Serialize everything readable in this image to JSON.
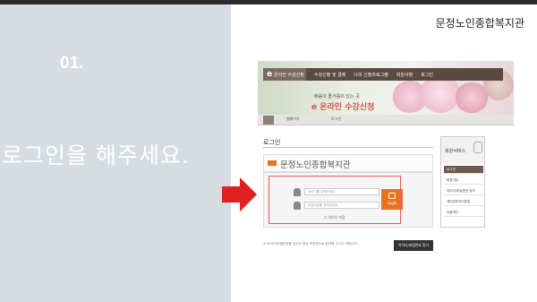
{
  "slide": {
    "title": "문정노인종합복지관",
    "step_number": "01.",
    "step_text": "로그인을 해주세요."
  },
  "site": {
    "logo_text": "온라인 수강신청",
    "nav": [
      "수강신청 및 결제",
      "나의 신청프로그램",
      "회원사항",
      "로그인"
    ],
    "slogan_small": "배움의 즐거움이 있는 곳",
    "slogan_large": "e 온라인 수강신청",
    "breadcrumbs": [
      "웹페이지",
      "로그인"
    ],
    "page_heading": "로그인",
    "org_name": "문정노인종합복지관",
    "id_placeholder": "아이디를 입력하세요",
    "pw_placeholder": "비밀번호를 입력하세요",
    "login_label": "Login",
    "save_id_label": "아이디 저장",
    "notice_text": "※ 아이디/비밀번호를 잊으신 경우 복지관으로 문의해 주시기 바랍니다.",
    "find_button": "아이디/비밀번호 찾기",
    "side_title": "회원서비스",
    "side_items": [
      "로그인",
      "회원가입",
      "아이디/비밀번호 찾기",
      "개인정보처리방침",
      "이용약관"
    ]
  },
  "colors": {
    "accent": "#e8731f",
    "highlight": "#e85a5a",
    "arrow": "#e02020",
    "left_panel": "#d6dde2"
  }
}
